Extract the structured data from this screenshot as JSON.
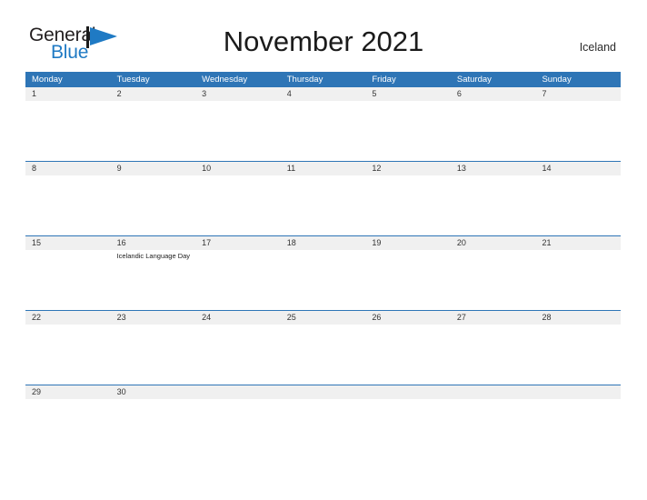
{
  "brand": {
    "name_part1": "General",
    "name_part2": "Blue",
    "mark_icon": "flag-triangle-icon",
    "accent_color": "#1f7ac4"
  },
  "header": {
    "title": "November 2021",
    "locale": "Iceland"
  },
  "calendar": {
    "header_bg_color": "#2e75b6",
    "number_band_color": "#f0f0f0",
    "weekdays": [
      "Monday",
      "Tuesday",
      "Wednesday",
      "Thursday",
      "Friday",
      "Saturday",
      "Sunday"
    ],
    "weeks": [
      {
        "days": [
          {
            "number": "1",
            "events": []
          },
          {
            "number": "2",
            "events": []
          },
          {
            "number": "3",
            "events": []
          },
          {
            "number": "4",
            "events": []
          },
          {
            "number": "5",
            "events": []
          },
          {
            "number": "6",
            "events": []
          },
          {
            "number": "7",
            "events": []
          }
        ]
      },
      {
        "days": [
          {
            "number": "8",
            "events": []
          },
          {
            "number": "9",
            "events": []
          },
          {
            "number": "10",
            "events": []
          },
          {
            "number": "11",
            "events": []
          },
          {
            "number": "12",
            "events": []
          },
          {
            "number": "13",
            "events": []
          },
          {
            "number": "14",
            "events": []
          }
        ]
      },
      {
        "days": [
          {
            "number": "15",
            "events": []
          },
          {
            "number": "16",
            "events": [
              "Icelandic Language Day"
            ]
          },
          {
            "number": "17",
            "events": []
          },
          {
            "number": "18",
            "events": []
          },
          {
            "number": "19",
            "events": []
          },
          {
            "number": "20",
            "events": []
          },
          {
            "number": "21",
            "events": []
          }
        ]
      },
      {
        "days": [
          {
            "number": "22",
            "events": []
          },
          {
            "number": "23",
            "events": []
          },
          {
            "number": "24",
            "events": []
          },
          {
            "number": "25",
            "events": []
          },
          {
            "number": "26",
            "events": []
          },
          {
            "number": "27",
            "events": []
          },
          {
            "number": "28",
            "events": []
          }
        ]
      },
      {
        "last": true,
        "days": [
          {
            "number": "29",
            "events": []
          },
          {
            "number": "30",
            "events": []
          },
          {
            "number": "",
            "events": []
          },
          {
            "number": "",
            "events": []
          },
          {
            "number": "",
            "events": []
          },
          {
            "number": "",
            "events": []
          },
          {
            "number": "",
            "events": []
          }
        ]
      }
    ]
  }
}
